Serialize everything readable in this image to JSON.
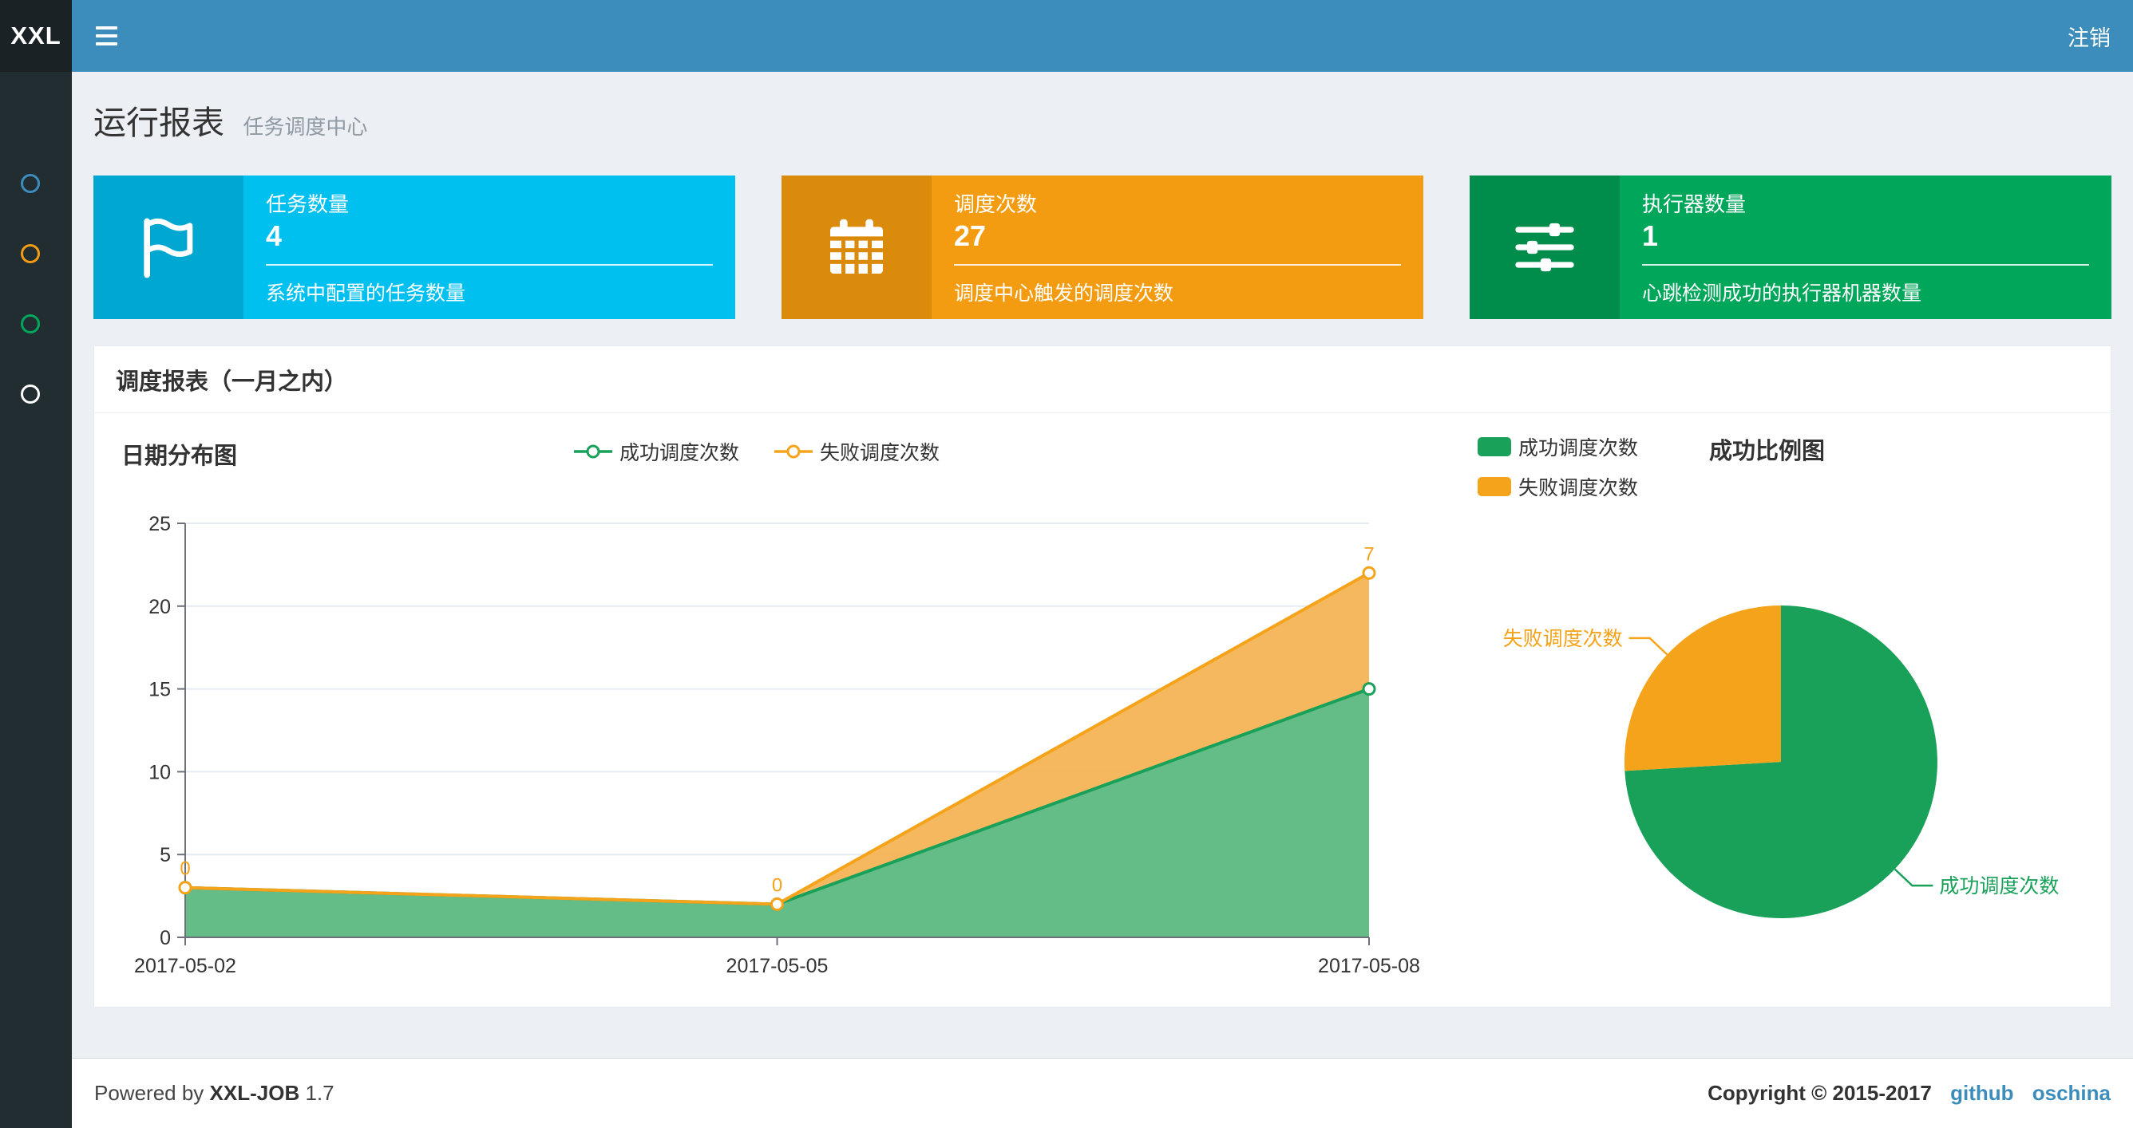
{
  "navbar": {
    "logo_text": "XXL",
    "logout_label": "注销"
  },
  "sidebar": {
    "items": [
      {
        "name": "menu-1",
        "color": "#3c8dbc"
      },
      {
        "name": "menu-2",
        "color": "#f39c12"
      },
      {
        "name": "menu-3",
        "color": "#00a65a"
      },
      {
        "name": "menu-4",
        "color": "#ffffff"
      }
    ]
  },
  "header": {
    "title": "运行报表",
    "subtitle": "任务调度中心"
  },
  "info_boxes": [
    {
      "icon": "flag-icon",
      "label": "任务数量",
      "value": "4",
      "desc": "系统中配置的任务数量",
      "color": "#00c0ef",
      "color_dark": "#00a7d0"
    },
    {
      "icon": "calendar-icon",
      "label": "调度次数",
      "value": "27",
      "desc": "调度中心触发的调度次数",
      "color": "#f39c12",
      "color_dark": "#db8b0b"
    },
    {
      "icon": "sliders-icon",
      "label": "执行器数量",
      "value": "1",
      "desc": "心跳检测成功的执行器机器数量",
      "color": "#00a65a",
      "color_dark": "#008d4c"
    }
  ],
  "panel": {
    "title": "调度报表（一月之内）"
  },
  "chart_data": [
    {
      "type": "area",
      "title": "日期分布图",
      "x": [
        "2017-05-02",
        "2017-05-05",
        "2017-05-08"
      ],
      "series": [
        {
          "name": "成功调度次数",
          "values": [
            3,
            2,
            15
          ],
          "color": "#19a15a",
          "fill": "#5cb87f"
        },
        {
          "name": "失败调度次数",
          "values": [
            0,
            0,
            7
          ],
          "stacked": true,
          "color": "#f5a31a",
          "fill": "#f5b04e",
          "point_labels": [
            "0",
            "0",
            "7"
          ]
        }
      ],
      "ylim": [
        0,
        25
      ],
      "yticks": [
        0,
        5,
        10,
        15,
        20,
        25
      ],
      "grid": true,
      "legend_position": "top-center"
    },
    {
      "type": "pie",
      "title": "成功比例图",
      "slices": [
        {
          "name": "成功调度次数",
          "value": 20,
          "color": "#19a15a"
        },
        {
          "name": "失败调度次数",
          "value": 7,
          "color": "#f5a31a"
        }
      ],
      "legend_position": "top-left"
    }
  ],
  "footer": {
    "powered_prefix": "Powered by",
    "product": "XXL-JOB",
    "version": "1.7",
    "copyright": "Copyright © 2015-2017",
    "links": [
      {
        "label": "github"
      },
      {
        "label": "oschina"
      }
    ]
  }
}
